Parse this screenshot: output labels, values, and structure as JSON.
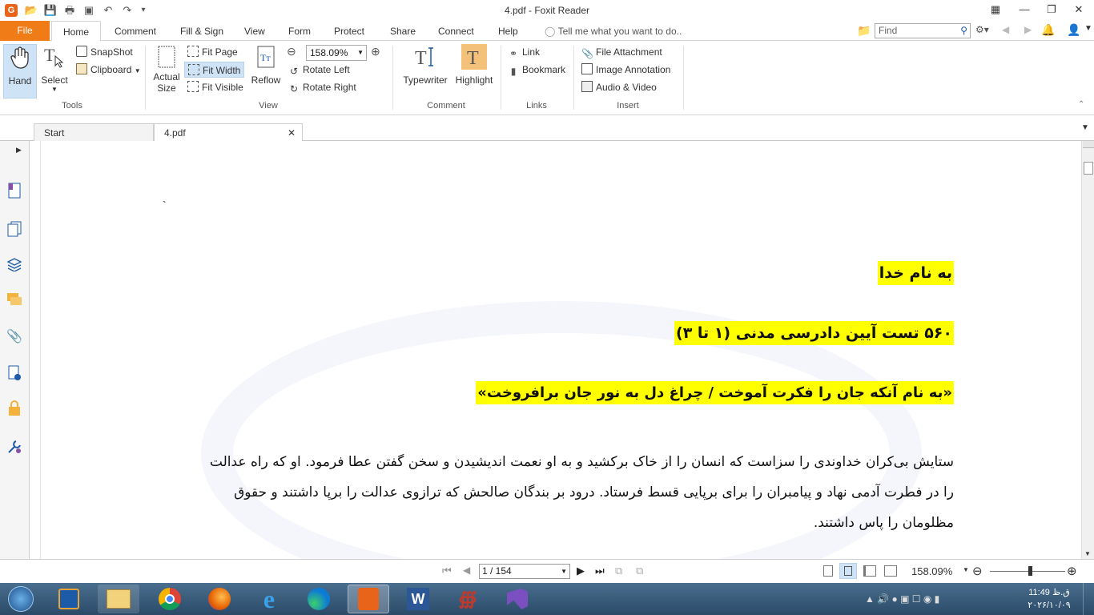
{
  "window": {
    "title": "4.pdf - Foxit Reader"
  },
  "menu_tabs": [
    "File",
    "Home",
    "Comment",
    "Fill & Sign",
    "View",
    "Form",
    "Protect",
    "Share",
    "Connect",
    "Help"
  ],
  "tell_me": "Tell me what you want to do..",
  "search": {
    "placeholder": "Find"
  },
  "ribbon": {
    "tools": {
      "hand": "Hand",
      "select": "Select",
      "snapshot": "SnapShot",
      "clipboard": "Clipboard",
      "label": "Tools"
    },
    "view": {
      "actual_size_1": "Actual",
      "actual_size_2": "Size",
      "fit_page": "Fit Page",
      "fit_width": "Fit Width",
      "fit_visible": "Fit Visible",
      "reflow": "Reflow",
      "zoom": "158.09%",
      "rotate_left": "Rotate Left",
      "rotate_right": "Rotate Right",
      "label": "View"
    },
    "comment": {
      "typewriter": "Typewriter",
      "highlight": "Highlight",
      "label": "Comment"
    },
    "links": {
      "link": "Link",
      "bookmark": "Bookmark",
      "label": "Links"
    },
    "insert": {
      "file_attachment": "File Attachment",
      "image_annotation": "Image Annotation",
      "audio_video": "Audio & Video",
      "label": "Insert"
    }
  },
  "doc_tabs": {
    "start": "Start",
    "current": "4.pdf"
  },
  "document": {
    "mark": "`",
    "h1": "به نام خدا",
    "h2": "۵۶۰ تست آیین دادرسی مدنی (۱ تا ۳)",
    "h3": "«به نام آنکه جان را فکرت آموخت / چراغ دل به نور جان برافروخت»",
    "p1": "ستایش بی‌کران خداوندی را سزاست که انسان را از خاک برکشید و به او نعمت اندیشیدن و سخن گفتن عطا فرمود. او که راه عدالت",
    "p2": "را در فطرت آدمی نهاد و پیامبران را برای برپایی قسط فرستاد. درود بر بندگان صالحش که ترازوی عدالت را برپا داشتند و حقوق",
    "p3": "مظلومان را پاس داشتند."
  },
  "status": {
    "page": "1 / 154",
    "zoom": "158.09%"
  },
  "clock": {
    "time": "11:49 ق.ظ",
    "date": "۲۰۲۶/۱۰/۰۹"
  }
}
